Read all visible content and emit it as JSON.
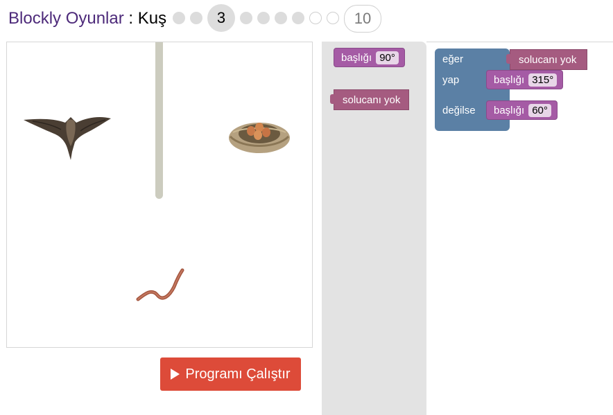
{
  "header": {
    "app_link": "Blockly Oyunlar",
    "separator": ":",
    "level_name": "Kuş",
    "current_level": "3",
    "last_level": "10"
  },
  "game": {
    "run_button": "Programı Çalıştır"
  },
  "toolbox": {
    "heading_label": "başlığı",
    "heading_angle": "90°",
    "sensor_label": "solucanı yok"
  },
  "workspace": {
    "if_label": "eğer",
    "do_label": "yap",
    "else_label": "değilse",
    "condition_label": "solucanı yok",
    "do_heading_label": "başlığı",
    "do_heading_angle": "315°",
    "else_heading_label": "başlığı",
    "else_heading_angle": "60°"
  },
  "colors": {
    "heading_block": "#a55ba5",
    "sensor_block": "#a55b80",
    "logic_block": "#5b80a5",
    "run_button": "#dd4b39",
    "title_link": "#4d2a7a"
  }
}
